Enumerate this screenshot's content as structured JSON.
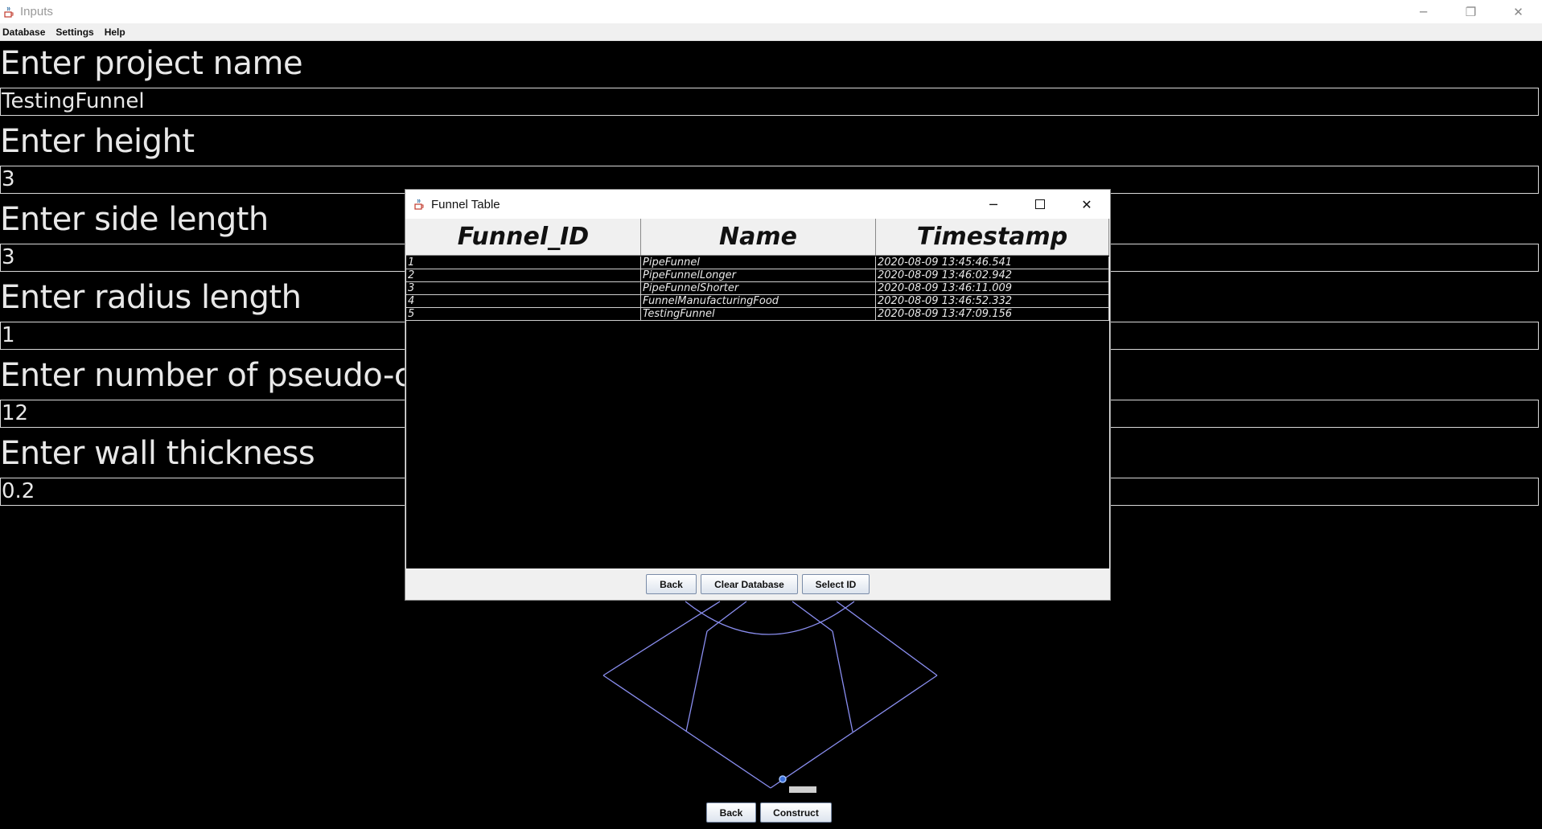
{
  "window": {
    "title": "Inputs",
    "controls": [
      "─",
      "❐",
      "✕"
    ]
  },
  "menu": [
    "Database",
    "Settings",
    "Help"
  ],
  "form": {
    "fields": [
      {
        "label": "Enter project name",
        "value": "TestingFunnel"
      },
      {
        "label": "Enter height",
        "value": "3"
      },
      {
        "label": "Enter side length",
        "value": "3"
      },
      {
        "label": "Enter radius length",
        "value": "1"
      },
      {
        "label": "Enter number of pseudo-cir",
        "value": "12"
      },
      {
        "label": "Enter wall thickness",
        "value": "0.2"
      }
    ]
  },
  "main_buttons": {
    "back": "Back",
    "construct": "Construct"
  },
  "dialog": {
    "title": "Funnel Table",
    "columns": [
      "Funnel_ID",
      "Name",
      "Timestamp"
    ],
    "rows": [
      [
        "1",
        "PipeFunnel",
        "2020-08-09 13:45:46.541"
      ],
      [
        "2",
        "PipeFunnelLonger",
        "2020-08-09 13:46:02.942"
      ],
      [
        "3",
        "PipeFunnelShorter",
        "2020-08-09 13:46:11.009"
      ],
      [
        "4",
        "FunnelManufacturingFood",
        "2020-08-09 13:46:52.332"
      ],
      [
        "5",
        "TestingFunnel",
        "2020-08-09 13:47:09.156"
      ]
    ],
    "buttons": {
      "back": "Back",
      "clear": "Clear Database",
      "select": "Select ID"
    }
  },
  "colors": {
    "wireframe": "#8a8ef0",
    "background": "#000000"
  },
  "icons": {
    "app": "java-cup-icon"
  }
}
